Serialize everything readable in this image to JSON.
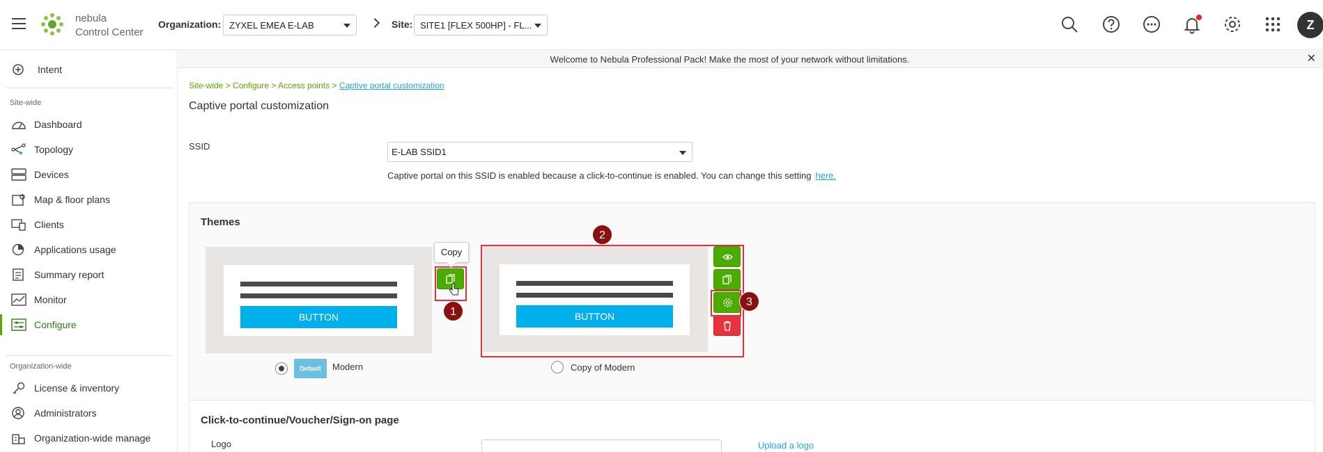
{
  "brand": {
    "line1": "nebula",
    "line2": "Control Center"
  },
  "header": {
    "org_label": "Organization:",
    "org_value": "ZYXEL EMEA E-LAB",
    "site_label": "Site:",
    "site_value": "SITE1 [FLEX 500HP] - FL...",
    "avatar_letter": "Z"
  },
  "sidebar": {
    "intent": "Intent",
    "site_section": "Site-wide",
    "site_items": [
      "Dashboard",
      "Topology",
      "Devices",
      "Map & floor plans",
      "Clients",
      "Applications usage",
      "Summary report",
      "Monitor",
      "Configure"
    ],
    "org_section": "Organization-wide",
    "org_items": [
      "License & inventory",
      "Administrators",
      "Organization-wide manage"
    ]
  },
  "banner": {
    "text": "Welcome to Nebula Professional Pack! Make the most of your network without limitations.",
    "close": "✕"
  },
  "breadcrumb": {
    "prefix": "Site-wide > Configure > Access points >",
    "current": "Captive portal customization"
  },
  "page_title": "Captive portal customization",
  "ssid": {
    "label": "SSID",
    "value": "E-LAB SSID1",
    "note": "Captive portal on this SSID is enabled because a click-to-continue is enabled. You can change this setting",
    "note_link": "here."
  },
  "themes": {
    "title": "Themes",
    "button_label": "BUTTON",
    "tooltip": "Copy",
    "default_badge": "Default",
    "theme1_name": "Modern",
    "theme2_name": "Copy of Modern",
    "markers": [
      "1",
      "2",
      "3"
    ]
  },
  "click_section": {
    "title": "Click-to-continue/Voucher/Sign-on page",
    "logo_label": "Logo",
    "upload_link": "Upload a logo"
  },
  "colors": {
    "accent_green": "#4cab00",
    "link_blue": "#1fa6d8",
    "danger_red": "#e8323e",
    "marker_dark_red": "#8a0f0f"
  },
  "icons": [
    "hamburger-icon",
    "nebula-logo-icon",
    "search-icon",
    "help-icon",
    "more-icon",
    "bell-icon",
    "gear-icon",
    "apps-grid-icon"
  ]
}
